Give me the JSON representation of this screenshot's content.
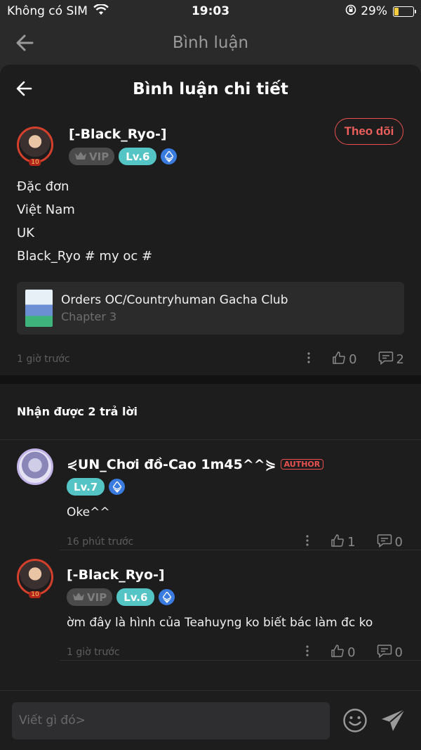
{
  "status": {
    "carrier": "Không có SIM",
    "time": "19:03",
    "battery": "29%",
    "battery_level": 0.29
  },
  "nav": {
    "title": "Bình luận"
  },
  "sheet": {
    "title": "Bình luận chi tiết"
  },
  "main_comment": {
    "username": "[-Black_Ryo-]",
    "vip_label": "VIP",
    "level": "Lv.6",
    "follow_label": "Theo dõi",
    "lines": [
      "Đặc đơn",
      "Việt Nam",
      "UK",
      "Black_Ryo # my oc #"
    ],
    "book": {
      "title": "Orders OC/Countryhuman Gacha Club",
      "chapter": "Chapter 3"
    },
    "time": "1 giờ trước",
    "likes": "0",
    "replies": "2"
  },
  "replies_header": "Nhận được 2 trả lời",
  "replies": [
    {
      "username": "⋞UN_Chơi đồ-Cao 1m45^^⋟",
      "author_tag": "AUTHOR",
      "level": "Lv.7",
      "text": "Oke^^",
      "time": "16 phút trước",
      "likes": "1",
      "replies": "0"
    },
    {
      "username": "[-Black_Ryo-]",
      "vip_label": "VIP",
      "level": "Lv.6",
      "text": "ờm đây là hình của Teahuyng ko biết bác làm đc ko",
      "time": "1 giờ trước",
      "likes": "0",
      "replies": "0"
    }
  ],
  "input": {
    "placeholder": "Viết gì đó>"
  },
  "colors": {
    "accent_red": "#e8514f",
    "level_teal": "#55c4c4",
    "eth_blue": "#3a7be0",
    "battery_yellow": "#f5cc3d"
  },
  "icons": [
    "wifi-icon",
    "back-arrow-icon",
    "ethereum-icon",
    "crown-icon",
    "more-dots-icon",
    "thumbs-up-icon",
    "comment-icon",
    "emoji-icon",
    "send-icon"
  ]
}
